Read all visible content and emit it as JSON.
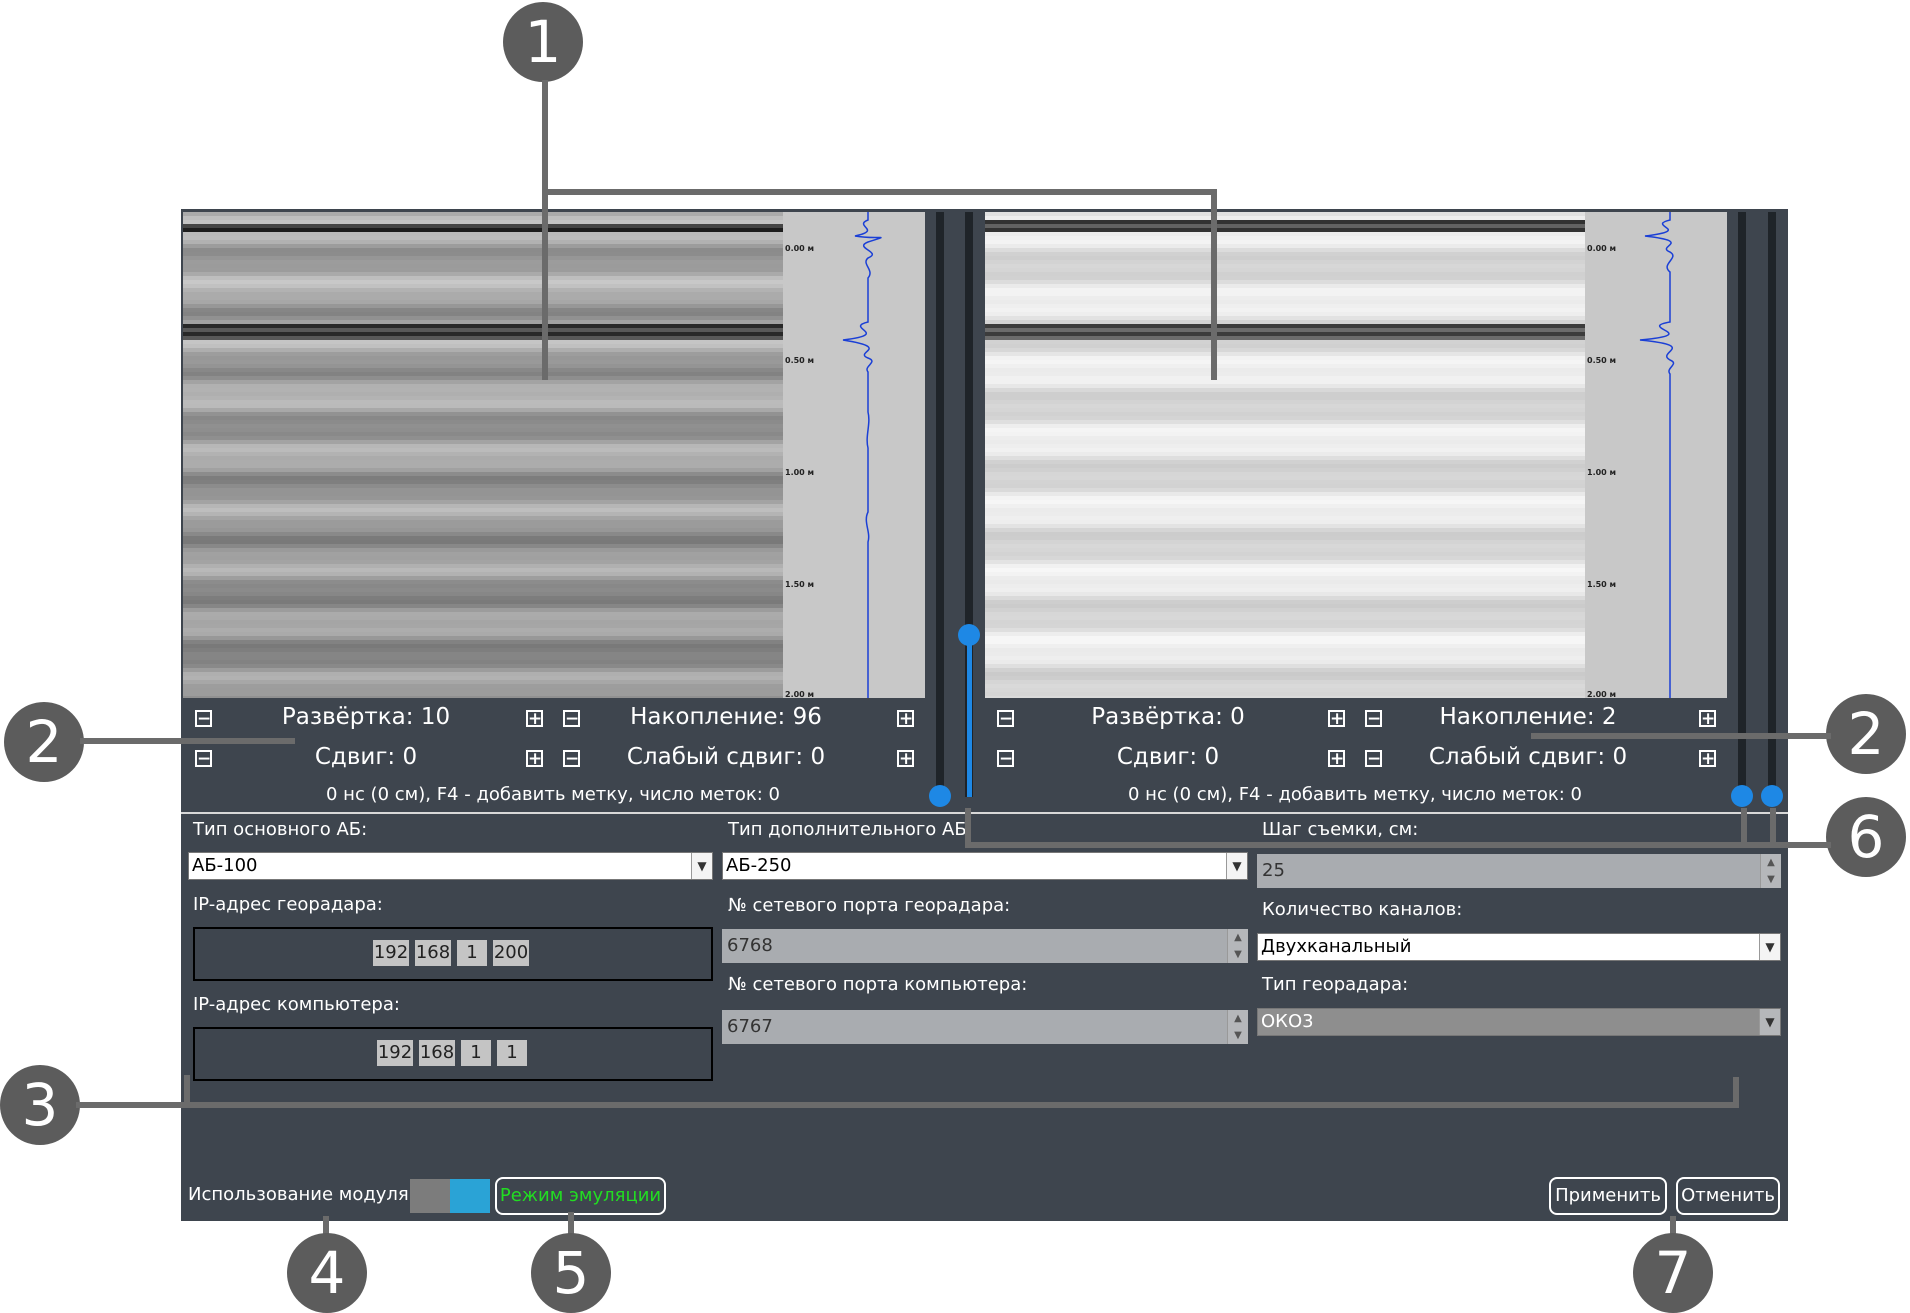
{
  "left_panel": {
    "sweep": "Развёртка: 10",
    "accumulation": "Накопление: 96",
    "shift": "Сдвиг: 0",
    "weak_shift": "Слабый сдвиг: 0",
    "status": "0 нс (0 см), F4 - добавить метку, число меток: 0",
    "depth_labels": [
      "0.00 м",
      "0.50 м",
      "1.00 м",
      "1.50 м",
      "2.00 м"
    ]
  },
  "right_panel": {
    "sweep": "Развёртка: 0",
    "accumulation": "Накопление: 2",
    "shift": "Сдвиг: 0",
    "weak_shift": "Слабый сдвиг: 0",
    "status": "0 нс (0 см), F4 - добавить метку, число меток: 0",
    "depth_labels": [
      "0.00 м",
      "0.50 м",
      "1.00 м",
      "1.50 м",
      "2.00 м"
    ]
  },
  "form": {
    "main_ab_label": "Тип основного АБ:",
    "main_ab_value": "АБ-100",
    "extra_ab_label": "Тип дополнительного АБ:",
    "extra_ab_value": "АБ-250",
    "step_label": "Шаг съемки, см:",
    "step_value": "25",
    "radar_ip_label": "IP-адрес георадара:",
    "radar_ip": [
      "192",
      "168",
      "1",
      "200"
    ],
    "radar_port_label": "№ сетевого порта георадара:",
    "radar_port_value": "6768",
    "channels_label": "Количество каналов:",
    "channels_value": "Двухканальный",
    "pc_ip_label": "IP-адрес компьютера:",
    "pc_ip": [
      "192",
      "168",
      "1",
      "1"
    ],
    "pc_port_label": "№ сетевого порта компьютера:",
    "pc_port_value": "6767",
    "radar_type_label": "Тип георадара:",
    "radar_type_value": "ОКО3"
  },
  "footer": {
    "module_label": "Использование модуля",
    "emulation_label": "Режим эмуляции",
    "apply_label": "Применить",
    "cancel_label": "Отменить"
  },
  "callouts": [
    "1",
    "2",
    "2",
    "3",
    "4",
    "5",
    "6",
    "7"
  ],
  "colors": {
    "panel_bg": "#3e454e",
    "accent_blue": "#1e88e5",
    "emulation_green": "#22dd22",
    "callout_gray": "#5c5c5c"
  }
}
